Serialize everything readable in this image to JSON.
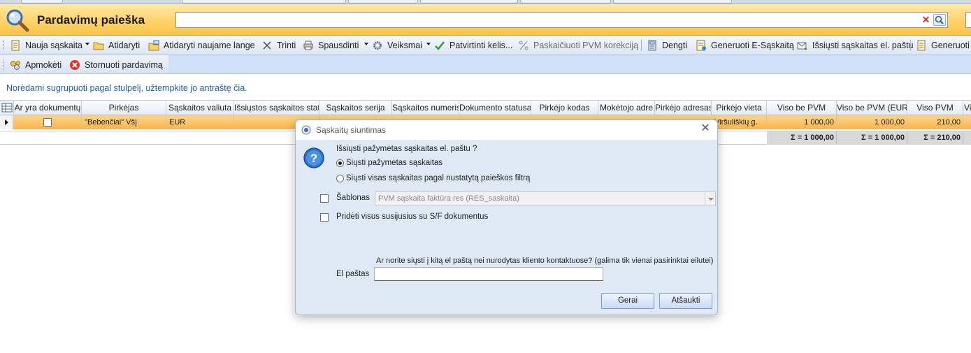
{
  "window": {
    "title": "Pardavimų paieška",
    "search": {
      "value": "",
      "placeholder": ""
    }
  },
  "toolbar1": {
    "items": [
      {
        "label": "Nauja sąskaita",
        "icon": "new-document-icon",
        "dropdown": true
      },
      {
        "label": "Atidaryti",
        "icon": "open-folder-icon"
      },
      {
        "label": "Atidaryti naujame lange",
        "icon": "open-new-window-icon"
      },
      {
        "label": "Trinti",
        "icon": "delete-x-icon"
      },
      {
        "label": "Spausdinti",
        "icon": "printer-icon",
        "dropdown": true
      },
      {
        "label": "Veiksmai",
        "icon": "gear-icon",
        "dropdown": true
      },
      {
        "label": "Patvirtinti kelis...",
        "icon": "checkmark-icon"
      },
      {
        "label": "Paskaičiuoti PVM korekciją",
        "icon": "percent-icon",
        "disabled": true
      },
      {
        "label": "Dengti",
        "icon": "calculator-icon"
      },
      {
        "label": "Generuoti E-Sąskaitą",
        "icon": "e-invoice-icon"
      },
      {
        "label": "Išsiųsti sąskaitas el. paštu",
        "icon": "email-send-icon"
      },
      {
        "label": "Generuoti",
        "icon": "generate-icon"
      }
    ]
  },
  "toolbar2": {
    "items": [
      {
        "label": "Apmokėti",
        "icon": "payment-icon"
      },
      {
        "label": "Stornuoti pardavimą",
        "icon": "cancel-red-icon"
      }
    ]
  },
  "grid": {
    "group_hint": "Norėdami sugrupuoti pagal stulpelį, užtempkite jo antraštę čia.",
    "columns": [
      "Ar yra dokumentų",
      "Pirkėjas",
      "Sąskaitos valiuta",
      "Išsiųstos sąskaitos stat",
      "Sąskaitos serija",
      "Sąskaitos numeris",
      "Dokumento statusa",
      "Pirkėjo kodas",
      "Mokėtojo adre",
      "Pirkėjo adresas",
      "Pirkėjo vieta",
      "Viso be PVM",
      "Viso be PVM (EUR)",
      "Viso PVM",
      "Vi"
    ],
    "rows": [
      {
        "has_docs": false,
        "buyer": "\"Bebenčiai\" VšĮ",
        "currency": "EUR",
        "sent_status": "",
        "series": "",
        "number": "",
        "doc_status": "",
        "buyer_code": "",
        "payer_address": "",
        "buyer_address": "",
        "buyer_place": "Viršuliškių g.",
        "total_ex_vat": "1 000,00",
        "total_ex_vat_eur": "1 000,00",
        "total_vat": "210,00"
      }
    ],
    "totals": {
      "total_ex_vat": "Σ = 1 000,00",
      "total_ex_vat_eur": "Σ = 1 000,00",
      "total_vat": "Σ = 210,00"
    }
  },
  "dialog": {
    "title": "Sąskaitų siuntimas",
    "question": "Išsiųsti pažymėtas sąskaitas el. paštu ?",
    "option_selected": "Siųsti pažymėtas sąskaitas",
    "option_filter": "Siųsti visas sąskaitas pagal nustatytą paieškos filtrą",
    "template_label": "Šablonas",
    "template_value": "PVM sąskaita faktūra res (RES_saskaita)",
    "attach_label": "Pridėti visus susijusius su S/F dokumentus",
    "other_email_question": "Ar norite siųsti į kitą el paštą nei nurodytas kliento kontaktuose? (galima tik vienai pasirinktai eilutei)",
    "email_label": "El paštas",
    "email_value": "",
    "ok_label": "Gerai",
    "cancel_label": "Atšaukti",
    "selected_option": "selected"
  }
}
